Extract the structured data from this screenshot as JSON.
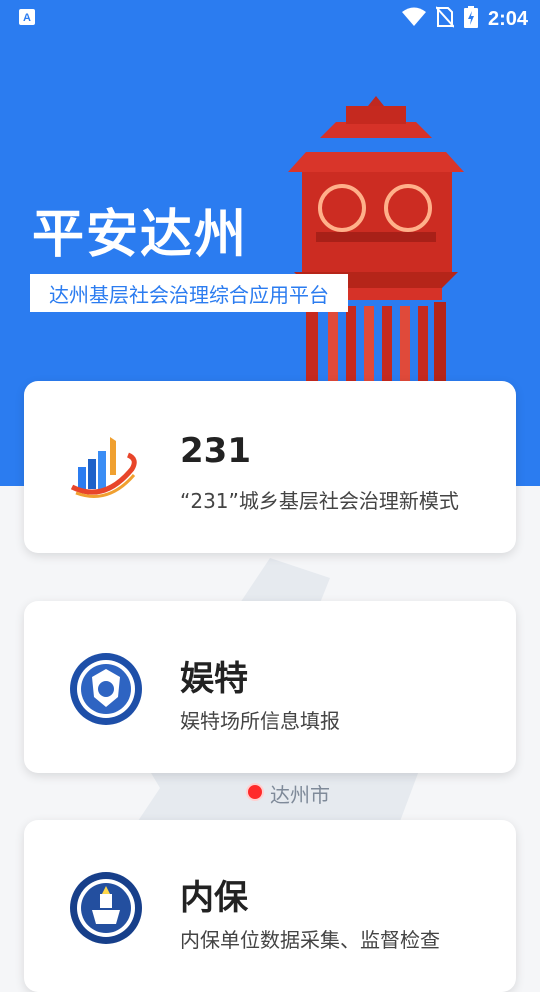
{
  "status_bar": {
    "time": "2:04",
    "left_icon": "a-notification-icon",
    "right_icons": [
      "wifi-icon",
      "no-sim-icon",
      "battery-charging-icon"
    ]
  },
  "header": {
    "title": "平安达州",
    "subtitle": "达州基层社会治理综合应用平台"
  },
  "map": {
    "city_label": "达州市"
  },
  "cards": [
    {
      "title": "231",
      "desc": "“231”城乡基层社会治理新模式",
      "icon": "chart-logo-icon"
    },
    {
      "title": "娱特",
      "desc": "娱特场所信息填报",
      "icon": "police-badge-icon"
    },
    {
      "title": "内保",
      "desc": "内保单位数据采集、监督检查",
      "icon": "security-badge-icon"
    }
  ],
  "colors": {
    "primary": "#2b7cf0",
    "tower_red": "#e0352b",
    "background": "#f5f6f8"
  }
}
